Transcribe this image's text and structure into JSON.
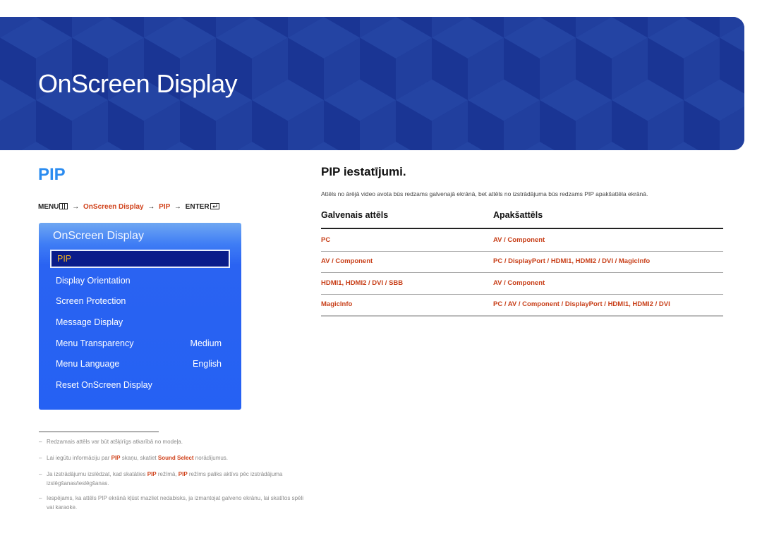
{
  "banner": {
    "title": "OnScreen Display"
  },
  "section": {
    "title": "PIP"
  },
  "menu_path": {
    "menu": "MENU",
    "menu_icon": "menu-grid-icon",
    "arrow": "→",
    "step1": "OnScreen Display",
    "step2": "PIP",
    "enter": "ENTER",
    "enter_icon": "enter-icon"
  },
  "osd": {
    "title": "OnScreen Display",
    "items": [
      {
        "label": "PIP",
        "value": "",
        "selected": true
      },
      {
        "label": "Display Orientation",
        "value": ""
      },
      {
        "label": "Screen Protection",
        "value": ""
      },
      {
        "label": "Message Display",
        "value": ""
      },
      {
        "label": "Menu Transparency",
        "value": "Medium"
      },
      {
        "label": "Menu Language",
        "value": "English"
      },
      {
        "label": "Reset OnScreen Display",
        "value": ""
      }
    ]
  },
  "pip_settings": {
    "title": "PIP iestatījumi.",
    "description": "Attēls no ārējā video avota būs redzams galvenajā ekrānā, bet attēls no izstrādājuma būs redzams PIP apakšattēla ekrānā.",
    "columns": [
      "Galvenais attēls",
      "Apakšattēls"
    ],
    "rows": [
      {
        "main": "PC",
        "sub": "AV / Component"
      },
      {
        "main": "AV / Component",
        "sub": "PC / DisplayPort / HDMI1, HDMI2 / DVI / MagicInfo"
      },
      {
        "main": "HDMI1, HDMI2 / DVI / SBB",
        "sub": "AV / Component"
      },
      {
        "main": "MagicInfo",
        "sub": "PC / AV / Component / DisplayPort / HDMI1, HDMI2 / DVI"
      }
    ]
  },
  "notes": {
    "dash": "–",
    "n1": "Redzamais attēls var būt atšķirīgs atkarībā no modeļa.",
    "n2_a": "Lai iegūtu informāciju par ",
    "n2_b": "PIP",
    "n2_c": " skaņu, skatiet ",
    "n2_d": "Sound Select",
    "n2_e": " norādījumus.",
    "n3_a": "Ja izstrādājumu izslēdzat, kad skatāties ",
    "n3_b": "PIP",
    "n3_c": " režīmā, ",
    "n3_d": "PIP",
    "n3_e": " režīms paliks aktīvs pēc izstrādājuma izslēgšanas/ieslēgšanas.",
    "n4": "Iespējams, ka attēls PIP ekrānā kļūst mazliet nedabisks, ja izmantojat galveno ekrānu, lai skatītos spēli vai karaoke."
  },
  "colors": {
    "banner_blue": "#1d3a9a",
    "section_title_blue": "#2b8cf0",
    "highlight_red": "#d0421b",
    "osd_blue": "#2561f3",
    "osd_selected_text": "#f0b020"
  }
}
